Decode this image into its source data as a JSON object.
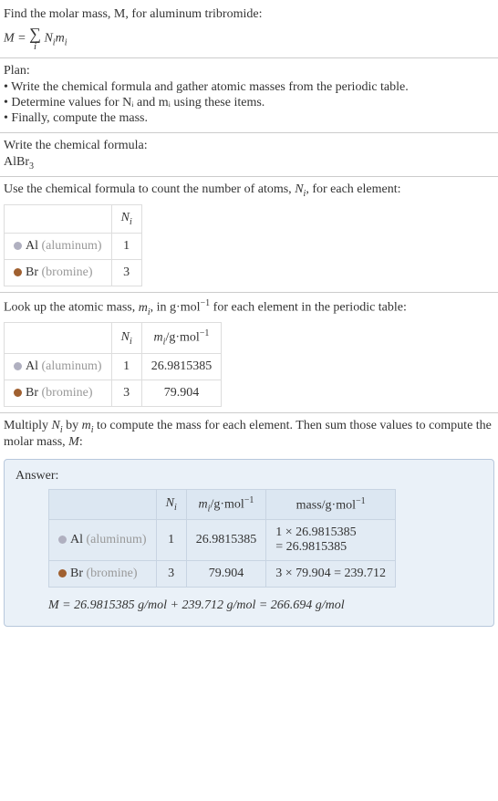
{
  "intro": {
    "line1": "Find the molar mass, M, for aluminum tribromide:",
    "formula_lhs": "M = ",
    "sum_var": "i",
    "formula_rhs_n": "N",
    "formula_rhs_m": "m"
  },
  "plan": {
    "heading": "Plan:",
    "items": [
      "• Write the chemical formula and gather atomic masses from the periodic table.",
      "• Determine values for Nᵢ and mᵢ using these items.",
      "• Finally, compute the mass."
    ]
  },
  "chemformula": {
    "heading": "Write the chemical formula:",
    "base": "AlBr",
    "sub": "3"
  },
  "count": {
    "heading_pre": "Use the chemical formula to count the number of atoms, ",
    "heading_var": "N",
    "heading_sub": "i",
    "heading_post": ", for each element:",
    "col_n": "N",
    "col_n_sub": "i",
    "rows": [
      {
        "sym": "Al",
        "name": "(aluminum)",
        "n": "1",
        "dot": "dot-al"
      },
      {
        "sym": "Br",
        "name": "(bromine)",
        "n": "3",
        "dot": "dot-br"
      }
    ]
  },
  "lookup": {
    "heading_pre": "Look up the atomic mass, ",
    "heading_var": "m",
    "heading_sub": "i",
    "heading_mid": ", in g·mol",
    "heading_sup": "−1",
    "heading_post": " for each element in the periodic table:",
    "col_n": "N",
    "col_n_sub": "i",
    "col_m": "m",
    "col_m_sub": "i",
    "col_m_unit": "/g·mol",
    "col_m_sup": "−1",
    "rows": [
      {
        "sym": "Al",
        "name": "(aluminum)",
        "n": "1",
        "m": "26.9815385",
        "dot": "dot-al"
      },
      {
        "sym": "Br",
        "name": "(bromine)",
        "n": "3",
        "m": "79.904",
        "dot": "dot-br"
      }
    ]
  },
  "multiply": {
    "text_pre": "Multiply ",
    "n": "N",
    "n_sub": "i",
    "text_mid": " by ",
    "m": "m",
    "m_sub": "i",
    "text_post": " to compute the mass for each element. Then sum those values to compute the molar mass, ",
    "mvar": "M",
    "text_end": ":"
  },
  "answer": {
    "label": "Answer:",
    "col_n": "N",
    "col_n_sub": "i",
    "col_m": "m",
    "col_m_sub": "i",
    "col_m_unit": "/g·mol",
    "col_m_sup": "−1",
    "col_mass": "mass/g·mol",
    "col_mass_sup": "−1",
    "rows": [
      {
        "sym": "Al",
        "name": "(aluminum)",
        "n": "1",
        "m": "26.9815385",
        "mass_l1": "1 × 26.9815385",
        "mass_l2": "= 26.9815385",
        "dot": "dot-al"
      },
      {
        "sym": "Br",
        "name": "(bromine)",
        "n": "3",
        "m": "79.904",
        "mass_l1": "3 × 79.904 = 239.712",
        "mass_l2": "",
        "dot": "dot-br"
      }
    ],
    "final": "M = 26.9815385 g/mol + 239.712 g/mol = 266.694 g/mol"
  }
}
